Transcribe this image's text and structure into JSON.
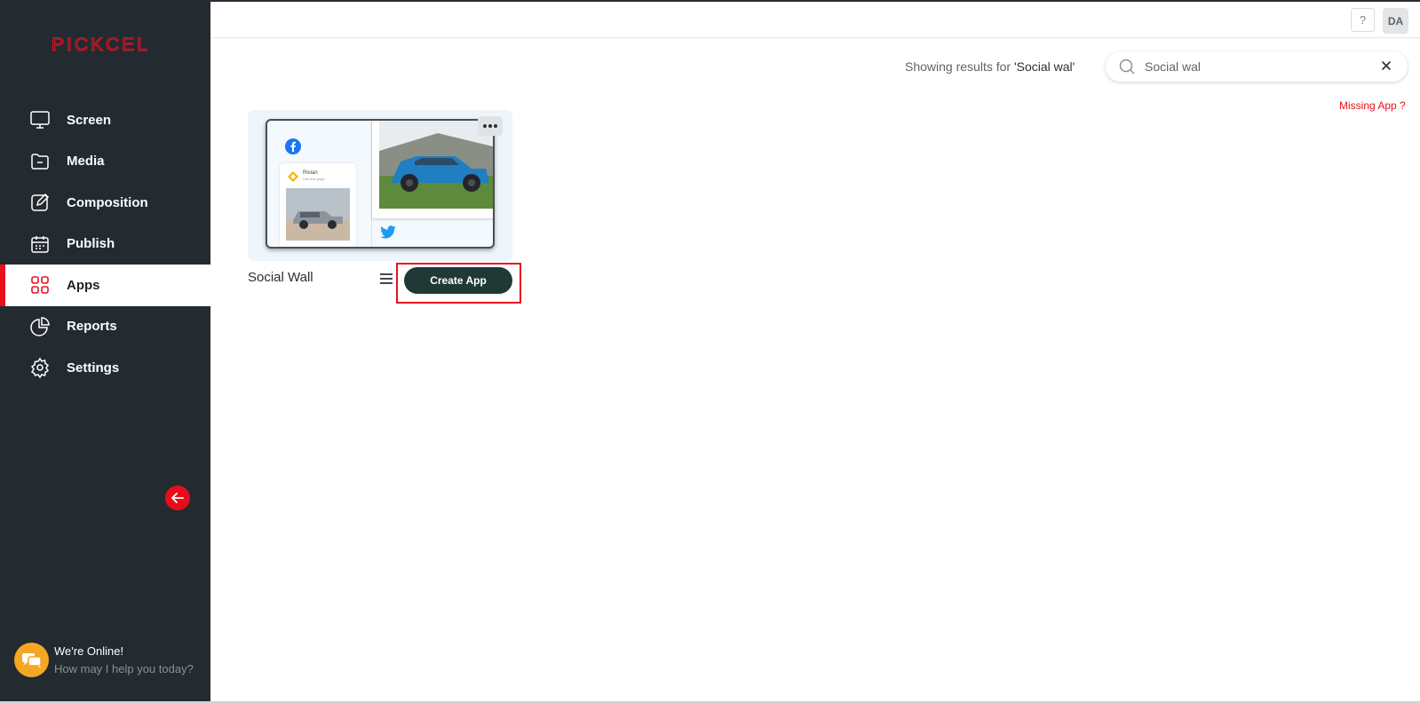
{
  "brand": {
    "logo_text": "PICKCEL",
    "accent": "#e8101e",
    "sidebar_bg": "#232a30"
  },
  "sidebar": {
    "items": [
      {
        "label": "Screen",
        "icon": "monitor-icon",
        "active": false
      },
      {
        "label": "Media",
        "icon": "folder-icon",
        "active": false
      },
      {
        "label": "Composition",
        "icon": "edit-icon",
        "active": false
      },
      {
        "label": "Publish",
        "icon": "calendar-icon",
        "active": false
      },
      {
        "label": "Apps",
        "icon": "apps-grid-icon",
        "active": true
      },
      {
        "label": "Reports",
        "icon": "pie-chart-icon",
        "active": false
      },
      {
        "label": "Settings",
        "icon": "gear-icon",
        "active": false
      }
    ],
    "chat": {
      "title": "We're Online!",
      "subtitle": "How may I help you today?"
    }
  },
  "topbar": {
    "help_label": "?",
    "avatar_initials": "DA"
  },
  "search": {
    "results_prefix": "Showing results for ",
    "results_query": "'Social wal'",
    "value": "Social wal",
    "missing_app": "Missing App ?"
  },
  "apps": [
    {
      "title": "Social Wall",
      "create_label": "Create App",
      "preview": {
        "post_name": "Rivian",
        "post_sub": "Like this page"
      }
    }
  ]
}
